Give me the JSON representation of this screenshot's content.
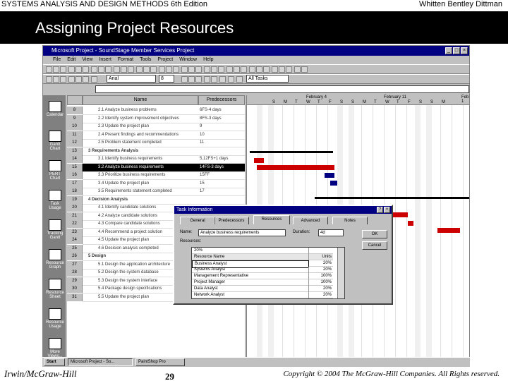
{
  "header": {
    "book_title": "SYSTEMS ANALYSIS AND DESIGN METHODS  6th Edition",
    "authors": "Whitten   Bentley   Dittman"
  },
  "slide_title": "Assigning Project Resources",
  "footer": {
    "publisher": "Irwin/McGraw-Hill",
    "page_number": "29",
    "copyright": "Copyright © 2004 The McGraw-Hill Companies. All Rights reserved."
  },
  "app": {
    "window_title": "Microsoft Project - SoundStage Member Services Project",
    "menu": [
      "File",
      "Edit",
      "View",
      "Insert",
      "Format",
      "Tools",
      "Project",
      "Window",
      "Help"
    ],
    "font_name": "Arial",
    "font_size": "8",
    "filter": "All Tasks",
    "view_bar": [
      "Calendar",
      "Gantt Chart",
      "PERT Chart",
      "Task Usage",
      "Tracking Gantt",
      "Resource Graph",
      "Resource Sheet",
      "Resource Usage",
      "More Views..."
    ],
    "sheet_headers": {
      "name": "Name",
      "predecessors": "Predecessors"
    },
    "tasks": [
      {
        "id": "8",
        "name": "2.1 Analyze business problems",
        "pred": "6FS-4 days"
      },
      {
        "id": "9",
        "name": "2.2 Identify system improvement objectives",
        "pred": "8FS-3 days"
      },
      {
        "id": "10",
        "name": "2.3 Update the project plan",
        "pred": "9"
      },
      {
        "id": "11",
        "name": "2.4 Present findings and recommendations",
        "pred": "10"
      },
      {
        "id": "12",
        "name": "2.5 Problem statement completed",
        "pred": "11"
      },
      {
        "id": "13",
        "name": "3 Requirements Analysis",
        "pred": ""
      },
      {
        "id": "14",
        "name": "3.1 Identify business requirements",
        "pred": "5,12FS+1 days"
      },
      {
        "id": "15",
        "name": "3.2 Analyze business requirements",
        "pred": "14FS-3 days"
      },
      {
        "id": "16",
        "name": "3.3 Prioritize business requirements",
        "pred": "15FF"
      },
      {
        "id": "17",
        "name": "3.4 Update the project plan",
        "pred": "15"
      },
      {
        "id": "18",
        "name": "3.5 Requirements statement completed",
        "pred": "17"
      },
      {
        "id": "19",
        "name": "4 Decision Analysis",
        "pred": ""
      },
      {
        "id": "20",
        "name": "4.1 Identify candidate solutions",
        "pred": ""
      },
      {
        "id": "21",
        "name": "4.2 Analyze candidate solutions",
        "pred": ""
      },
      {
        "id": "22",
        "name": "4.3 Compare candidate solutions",
        "pred": ""
      },
      {
        "id": "23",
        "name": "4.4 Recommend a project solution",
        "pred": ""
      },
      {
        "id": "24",
        "name": "4.5 Update the project plan",
        "pred": ""
      },
      {
        "id": "25",
        "name": "4.6 Decision analysis completed",
        "pred": ""
      },
      {
        "id": "26",
        "name": "5 Design",
        "pred": ""
      },
      {
        "id": "27",
        "name": "5.1 Design the application architecture",
        "pred": ""
      },
      {
        "id": "28",
        "name": "5.2 Design the system database",
        "pred": ""
      },
      {
        "id": "29",
        "name": "5.3 Design the system interface",
        "pred": ""
      },
      {
        "id": "30",
        "name": "5.4 Package design specifications",
        "pred": ""
      },
      {
        "id": "31",
        "name": "5.5 Update the project plan",
        "pred": ""
      }
    ],
    "gantt_weeks": [
      "February 4",
      "February 11",
      "Feb 1"
    ],
    "gantt_days": [
      "S",
      "M",
      "T",
      "W",
      "T",
      "F",
      "S",
      "S",
      "M",
      "T",
      "W",
      "T",
      "F",
      "S",
      "S",
      "M"
    ]
  },
  "dialog": {
    "title": "Task Information",
    "tabs": [
      "General",
      "Predecessors",
      "Resources",
      "Advanced",
      "Notes"
    ],
    "name_label": "Name:",
    "name_value": "Analyze business requirements",
    "duration_label": "Duration:",
    "duration_value": "4d",
    "resources_label": "Resources:",
    "units_entry": "20%",
    "col_resource": "Resource Name",
    "col_units": "Units",
    "resources": [
      {
        "name": "Business Analyst",
        "units": "20%"
      },
      {
        "name": "Systems Analyst",
        "units": "20%"
      },
      {
        "name": "Management Representative",
        "units": "100%"
      },
      {
        "name": "Project Manager",
        "units": "100%"
      },
      {
        "name": "Data Analyst",
        "units": "20%"
      },
      {
        "name": "Network Analyst",
        "units": "20%"
      }
    ],
    "ok_label": "OK",
    "cancel_label": "Cancel"
  },
  "taskbar": {
    "start": "Start",
    "items": [
      "Microsoft Project - So...",
      "PaintShop Pro"
    ]
  }
}
